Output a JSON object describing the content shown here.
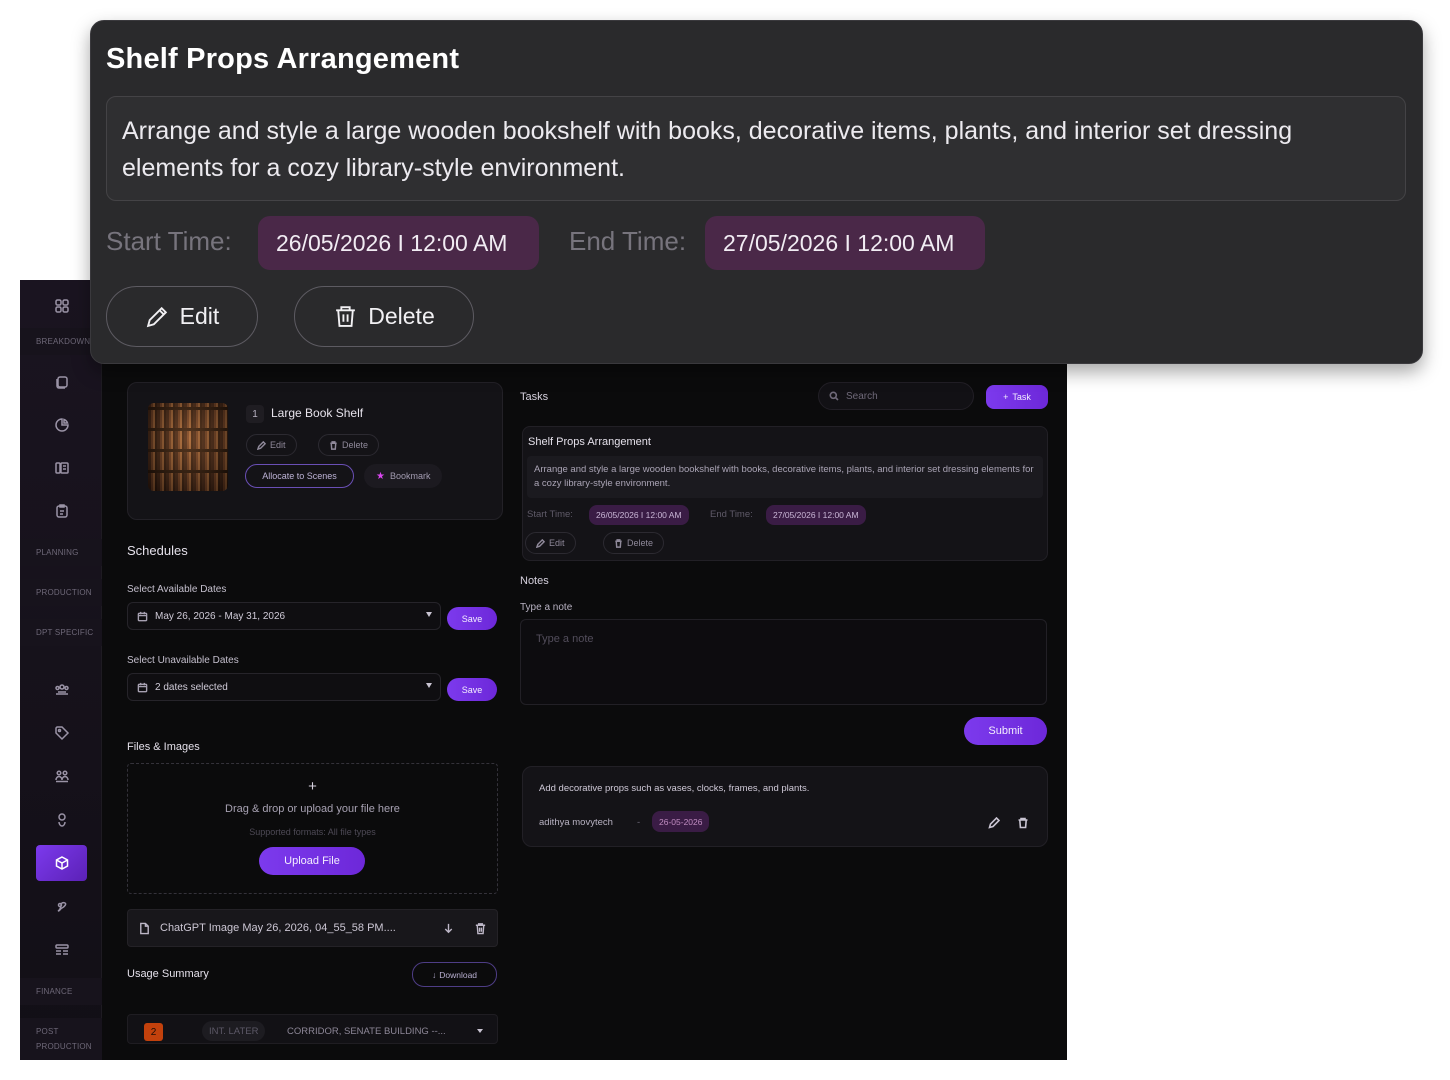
{
  "popover": {
    "title": "Shelf Props Arrangement",
    "description": "Arrange and style a large wooden bookshelf with books, decorative items, plants, and interior set dressing elements for a cozy library-style environment.",
    "start_label": "Start Time:",
    "start_value": "26/05/2026  I 12:00 AM",
    "end_label": "End Time:",
    "end_value": "27/05/2026  I 12:00 AM",
    "edit_label": "Edit",
    "delete_label": "Delete"
  },
  "sidebar": {
    "labels": {
      "breakdown": "BREAKDOWN",
      "planning": "PLANNING",
      "production": "PRODUCTION",
      "dpt_specific": "DPT SPECIFIC",
      "finance": "FINANCE",
      "post_production": "POST PRODUCTION"
    }
  },
  "prop": {
    "number": "1",
    "name": "Large Book Shelf",
    "edit": "Edit",
    "delete": "Delete",
    "allocate": "Allocate to Scenes",
    "bookmark": "Bookmark"
  },
  "schedules": {
    "title": "Schedules",
    "available_label": "Select Available Dates",
    "available_value": "May 26, 2026 - May 31, 2026",
    "unavailable_label": "Select Unavailable Dates",
    "unavailable_value": "2 dates selected",
    "save": "Save"
  },
  "files": {
    "title": "Files & Images",
    "plus": "+",
    "drop_text": "Drag & drop or upload your file here",
    "formats": "Supported formats: All file types",
    "upload": "Upload File",
    "file_name": "ChatGPT Image May 26, 2026, 04_55_58 PM...."
  },
  "usage": {
    "title": "Usage Summary",
    "download": "Download",
    "row_num": "2",
    "row_tag": "INT. LATER",
    "row_location": "CORRIDOR, SENATE BUILDING --..."
  },
  "tasks": {
    "title": "Tasks",
    "search_placeholder": "Search",
    "add_task": "Task",
    "card_title": "Shelf Props Arrangement",
    "card_desc": "Arrange and style a large wooden bookshelf with books, decorative items, plants, and interior set dressing elements for a cozy library-style environment.",
    "start_label": "Start Time:",
    "start_value": "26/05/2026  I 12:00 AM",
    "end_label": "End Time:",
    "end_value": "27/05/2026  I 12:00 AM",
    "edit": "Edit",
    "delete": "Delete"
  },
  "notes": {
    "title": "Notes",
    "input_label": "Type a note",
    "placeholder": "Type a note",
    "submit": "Submit",
    "note_text": "Add decorative props such as vases, clocks, frames, and plants.",
    "author": "adithya movytech",
    "separator": "-",
    "date": "26-05-2026"
  },
  "colors": {
    "accent": "#7c3aed",
    "date_pill": "#3a1c45",
    "popover_bg": "#2a2a2c"
  }
}
